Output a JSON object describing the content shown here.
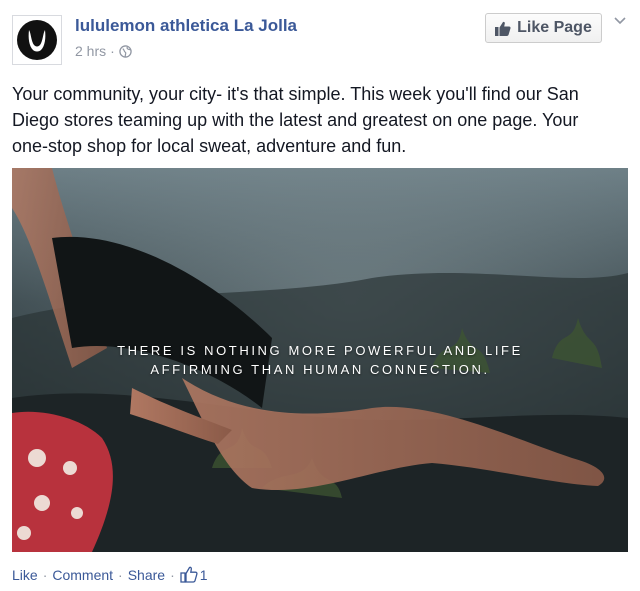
{
  "post": {
    "page_name": "lululemon athletica La Jolla",
    "time": "2 hrs",
    "meta_separator": "·",
    "like_page_label": "Like Page",
    "text": "Your community, your city- it's that simple. This week you'll find our San Diego stores teaming up with the latest and greatest on one page. Your one-stop shop for local sweat, adventure and fun.",
    "photo_quote": {
      "line1": "THERE IS NOTHING MORE POWERFUL AND LIFE",
      "line2": "AFFIRMING THAN HUMAN CONNECTION."
    }
  },
  "actions": {
    "like": "Like",
    "comment": "Comment",
    "share": "Share",
    "separator": "·",
    "like_count": "1"
  },
  "icons": {
    "logo": "lululemon-logo-icon",
    "privacy": "globe-icon",
    "like_page": "thumbs-up-icon",
    "menu": "chevron-down-icon",
    "likes": "thumbs-up-outline-icon"
  },
  "colors": {
    "link": "#3b5998",
    "meta": "#9197a3",
    "text": "#141823",
    "logo_red": "#d31a38"
  }
}
